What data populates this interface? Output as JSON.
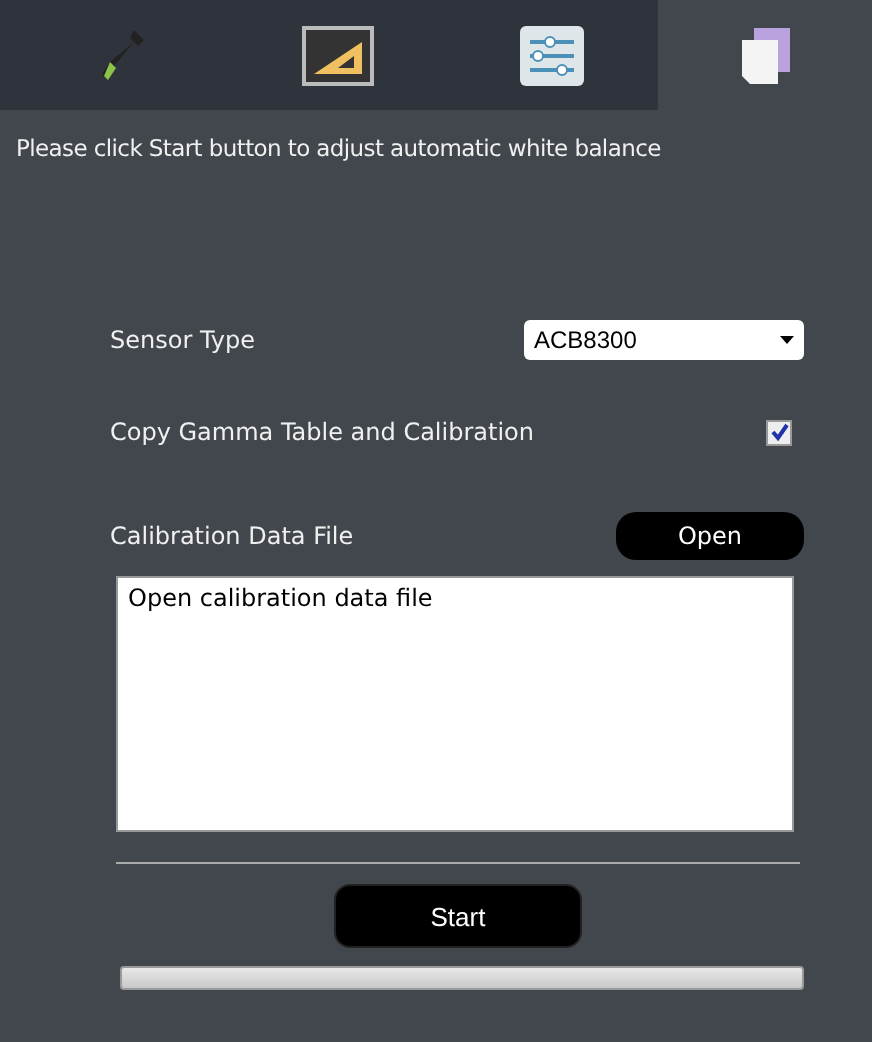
{
  "tabs": [
    {
      "kind": "dropper",
      "selected": false
    },
    {
      "kind": "ruler",
      "selected": false
    },
    {
      "kind": "sliders",
      "selected": false
    },
    {
      "kind": "pages",
      "selected": true
    }
  ],
  "instruction": "Please click Start button to adjust automatic white balance",
  "sensor_type": {
    "label": "Sensor Type",
    "value": "ACB8300"
  },
  "copy_gamma": {
    "label": "Copy Gamma Table and Calibration",
    "checked": true
  },
  "calibration": {
    "label": "Calibration Data File",
    "button": "Open",
    "text": "Open calibration data file"
  },
  "start_button": "Start",
  "progress": {
    "level": 0
  }
}
